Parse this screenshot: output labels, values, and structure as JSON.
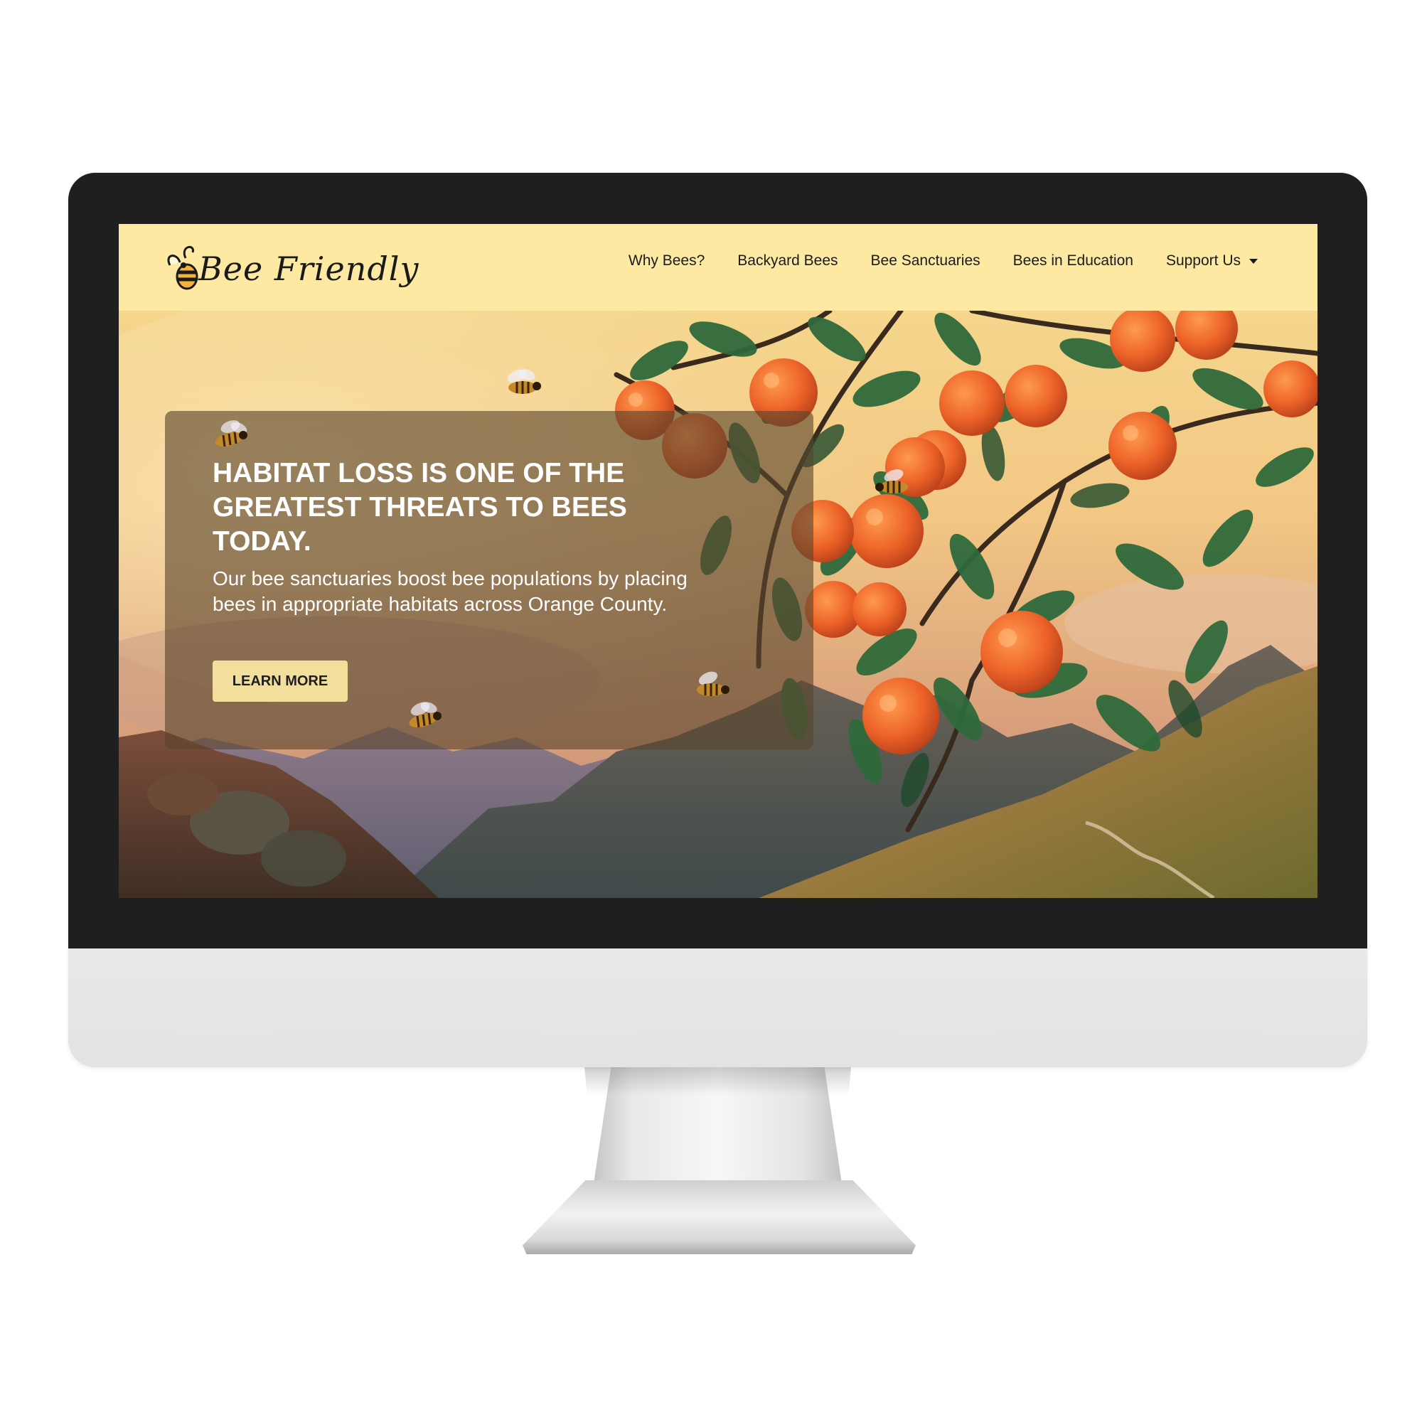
{
  "brand": {
    "logo_text": "Bee Friendly"
  },
  "nav": {
    "items": [
      {
        "label": "Why Bees?"
      },
      {
        "label": "Backyard Bees"
      },
      {
        "label": "Bee Sanctuaries"
      },
      {
        "label": "Bees in Education"
      },
      {
        "label": "Support Us"
      }
    ]
  },
  "hero": {
    "title": "HABITAT LOSS IS ONE OF THE GREATEST THREATS TO BEES TODAY.",
    "body": "Our bee sanctuaries boost bee populations by placing bees in appropriate habitats across Orange County.",
    "cta_label": "LEARN MORE"
  },
  "colors": {
    "header_bg": "#fde9a1",
    "button_bg": "#f3df9c",
    "bezel": "#1f1f1f",
    "chin": "#e5e6e5",
    "orange": "#e8642a",
    "leaf": "#2f6a3c"
  }
}
